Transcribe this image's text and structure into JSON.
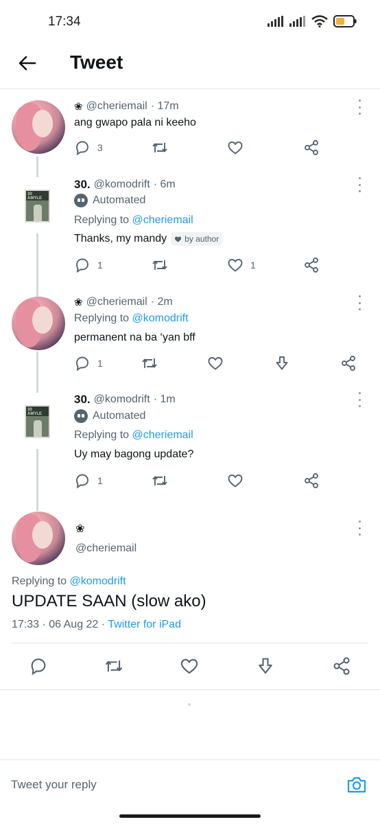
{
  "status_bar": {
    "time": "17:34"
  },
  "header": {
    "title": "Tweet"
  },
  "tweets": [
    {
      "flower": "❀",
      "handle": "@cheriemail",
      "time": "· 17m",
      "text": "ang gwapo pala ni keeho",
      "reply_count": "3",
      "like_count": ""
    },
    {
      "display_name": "30.",
      "handle": "@komodrift",
      "time": "· 6m",
      "automated_label": "Automated",
      "replying_prefix": "Replying to",
      "replying_to": "@cheriemail",
      "text": "Thanks, my mandy",
      "badge": "by author",
      "reply_count": "1",
      "like_count": "1",
      "avatar_text": "30 AMYLE"
    },
    {
      "flower": "❀",
      "handle": "@cheriemail",
      "time": "· 2m",
      "replying_prefix": "Replying to",
      "replying_to": "@komodrift",
      "text": "permanent na ba ‘yan bff",
      "reply_count": "1"
    },
    {
      "display_name": "30.",
      "handle": "@komodrift",
      "time": "· 1m",
      "automated_label": "Automated",
      "replying_prefix": "Replying to",
      "replying_to": "@cheriemail",
      "text": "Uy may bagong update?",
      "reply_count": "1",
      "avatar_text": "30 AMYLE"
    }
  ],
  "main_tweet": {
    "flower": "❀",
    "handle": "@cheriemail",
    "replying_prefix": "Replying to",
    "replying_to": "@komodrift",
    "text": "UPDATE SAAN (slow ako)",
    "timestamp": "17:33 · 06 Aug 22 ·",
    "source": "Twitter for iPad"
  },
  "reply_bar": {
    "placeholder": "Tweet your reply"
  },
  "colors": {
    "accent": "#1d9bf0",
    "text": "#0f1419",
    "muted": "#536471",
    "divider": "#e1e4e7"
  },
  "icons": [
    "back-arrow-icon",
    "reply-icon",
    "retweet-icon",
    "like-icon",
    "share-icon",
    "download-icon",
    "more-icon",
    "robot-icon",
    "camera-icon",
    "signal-icon",
    "wifi-icon",
    "battery-icon"
  ]
}
